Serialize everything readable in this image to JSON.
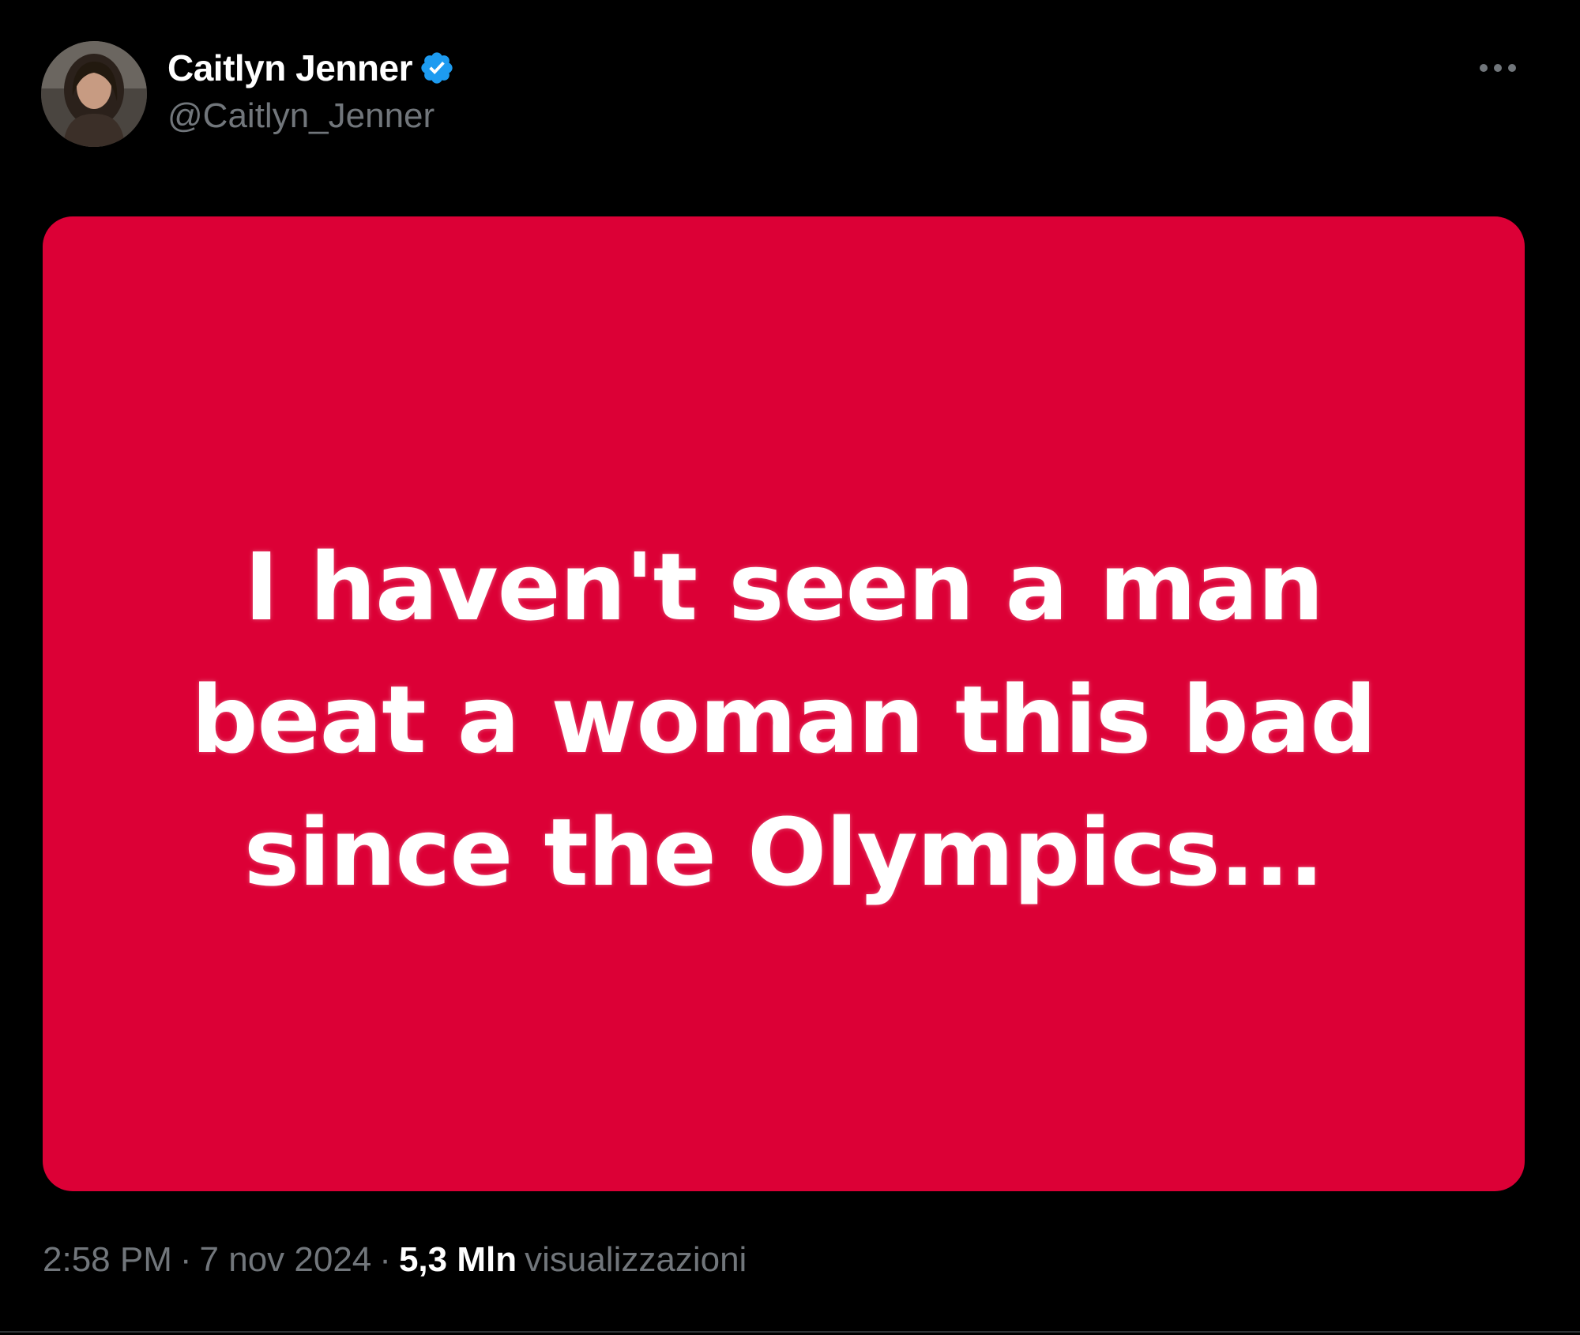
{
  "tweet": {
    "author": {
      "display_name": "Caitlyn Jenner",
      "handle": "@Caitlyn_Jenner",
      "verified": true
    },
    "media_text": "I haven't seen a man\nbeat a woman this bad\nsince the Olympics...",
    "meta": {
      "time": "2:58 PM",
      "separator": "·",
      "date": "7 nov 2024",
      "views_count": "5,3 Mln",
      "views_label": "visualizzazioni"
    }
  },
  "colors": {
    "background": "#000000",
    "media_background": "#dc0036",
    "verified_badge": "#1d9bf0",
    "secondary_text": "#71767b"
  },
  "icons": {
    "verified": "verified-badge-icon",
    "more": "more-options-icon"
  }
}
